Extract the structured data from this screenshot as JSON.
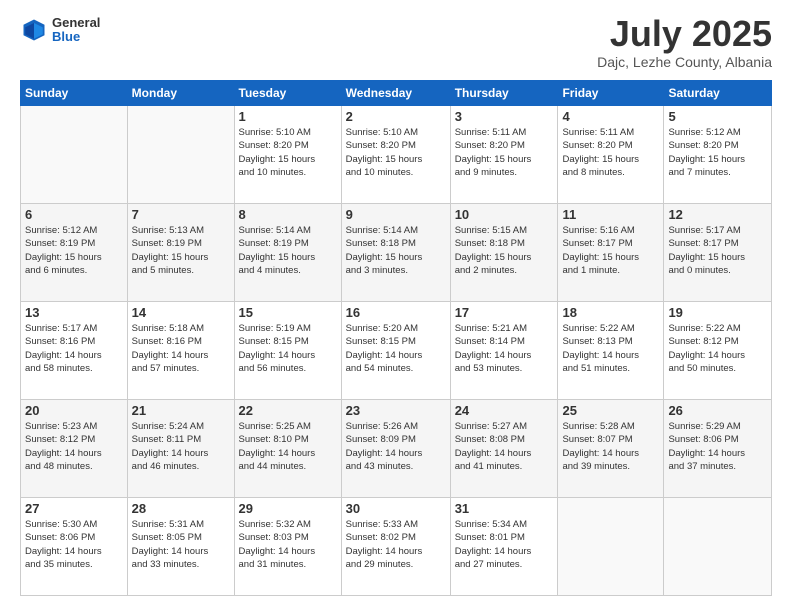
{
  "header": {
    "logo": {
      "general": "General",
      "blue": "Blue"
    },
    "title": "July 2025",
    "location": "Dajc, Lezhe County, Albania"
  },
  "weekdays": [
    "Sunday",
    "Monday",
    "Tuesday",
    "Wednesday",
    "Thursday",
    "Friday",
    "Saturday"
  ],
  "weeks": [
    [
      {
        "day": "",
        "info": ""
      },
      {
        "day": "",
        "info": ""
      },
      {
        "day": "1",
        "info": "Sunrise: 5:10 AM\nSunset: 8:20 PM\nDaylight: 15 hours\nand 10 minutes."
      },
      {
        "day": "2",
        "info": "Sunrise: 5:10 AM\nSunset: 8:20 PM\nDaylight: 15 hours\nand 10 minutes."
      },
      {
        "day": "3",
        "info": "Sunrise: 5:11 AM\nSunset: 8:20 PM\nDaylight: 15 hours\nand 9 minutes."
      },
      {
        "day": "4",
        "info": "Sunrise: 5:11 AM\nSunset: 8:20 PM\nDaylight: 15 hours\nand 8 minutes."
      },
      {
        "day": "5",
        "info": "Sunrise: 5:12 AM\nSunset: 8:20 PM\nDaylight: 15 hours\nand 7 minutes."
      }
    ],
    [
      {
        "day": "6",
        "info": "Sunrise: 5:12 AM\nSunset: 8:19 PM\nDaylight: 15 hours\nand 6 minutes."
      },
      {
        "day": "7",
        "info": "Sunrise: 5:13 AM\nSunset: 8:19 PM\nDaylight: 15 hours\nand 5 minutes."
      },
      {
        "day": "8",
        "info": "Sunrise: 5:14 AM\nSunset: 8:19 PM\nDaylight: 15 hours\nand 4 minutes."
      },
      {
        "day": "9",
        "info": "Sunrise: 5:14 AM\nSunset: 8:18 PM\nDaylight: 15 hours\nand 3 minutes."
      },
      {
        "day": "10",
        "info": "Sunrise: 5:15 AM\nSunset: 8:18 PM\nDaylight: 15 hours\nand 2 minutes."
      },
      {
        "day": "11",
        "info": "Sunrise: 5:16 AM\nSunset: 8:17 PM\nDaylight: 15 hours\nand 1 minute."
      },
      {
        "day": "12",
        "info": "Sunrise: 5:17 AM\nSunset: 8:17 PM\nDaylight: 15 hours\nand 0 minutes."
      }
    ],
    [
      {
        "day": "13",
        "info": "Sunrise: 5:17 AM\nSunset: 8:16 PM\nDaylight: 14 hours\nand 58 minutes."
      },
      {
        "day": "14",
        "info": "Sunrise: 5:18 AM\nSunset: 8:16 PM\nDaylight: 14 hours\nand 57 minutes."
      },
      {
        "day": "15",
        "info": "Sunrise: 5:19 AM\nSunset: 8:15 PM\nDaylight: 14 hours\nand 56 minutes."
      },
      {
        "day": "16",
        "info": "Sunrise: 5:20 AM\nSunset: 8:15 PM\nDaylight: 14 hours\nand 54 minutes."
      },
      {
        "day": "17",
        "info": "Sunrise: 5:21 AM\nSunset: 8:14 PM\nDaylight: 14 hours\nand 53 minutes."
      },
      {
        "day": "18",
        "info": "Sunrise: 5:22 AM\nSunset: 8:13 PM\nDaylight: 14 hours\nand 51 minutes."
      },
      {
        "day": "19",
        "info": "Sunrise: 5:22 AM\nSunset: 8:12 PM\nDaylight: 14 hours\nand 50 minutes."
      }
    ],
    [
      {
        "day": "20",
        "info": "Sunrise: 5:23 AM\nSunset: 8:12 PM\nDaylight: 14 hours\nand 48 minutes."
      },
      {
        "day": "21",
        "info": "Sunrise: 5:24 AM\nSunset: 8:11 PM\nDaylight: 14 hours\nand 46 minutes."
      },
      {
        "day": "22",
        "info": "Sunrise: 5:25 AM\nSunset: 8:10 PM\nDaylight: 14 hours\nand 44 minutes."
      },
      {
        "day": "23",
        "info": "Sunrise: 5:26 AM\nSunset: 8:09 PM\nDaylight: 14 hours\nand 43 minutes."
      },
      {
        "day": "24",
        "info": "Sunrise: 5:27 AM\nSunset: 8:08 PM\nDaylight: 14 hours\nand 41 minutes."
      },
      {
        "day": "25",
        "info": "Sunrise: 5:28 AM\nSunset: 8:07 PM\nDaylight: 14 hours\nand 39 minutes."
      },
      {
        "day": "26",
        "info": "Sunrise: 5:29 AM\nSunset: 8:06 PM\nDaylight: 14 hours\nand 37 minutes."
      }
    ],
    [
      {
        "day": "27",
        "info": "Sunrise: 5:30 AM\nSunset: 8:06 PM\nDaylight: 14 hours\nand 35 minutes."
      },
      {
        "day": "28",
        "info": "Sunrise: 5:31 AM\nSunset: 8:05 PM\nDaylight: 14 hours\nand 33 minutes."
      },
      {
        "day": "29",
        "info": "Sunrise: 5:32 AM\nSunset: 8:03 PM\nDaylight: 14 hours\nand 31 minutes."
      },
      {
        "day": "30",
        "info": "Sunrise: 5:33 AM\nSunset: 8:02 PM\nDaylight: 14 hours\nand 29 minutes."
      },
      {
        "day": "31",
        "info": "Sunrise: 5:34 AM\nSunset: 8:01 PM\nDaylight: 14 hours\nand 27 minutes."
      },
      {
        "day": "",
        "info": ""
      },
      {
        "day": "",
        "info": ""
      }
    ]
  ]
}
